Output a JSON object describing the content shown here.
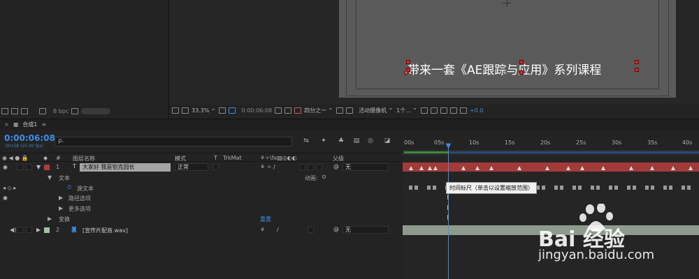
{
  "viewer": {
    "overlay_text": "带来一套《AE跟踪与应用》系列课程",
    "bpc": "8 bpc",
    "zoom": "33.3%",
    "timecode": "0:00:06:08",
    "resolution": "四分之一",
    "camera": "活动摄像机",
    "views": "1个...",
    "exposure": "+0.0"
  },
  "panel": {
    "tab_label": "合成1",
    "menu_icon": "hamburger-icon"
  },
  "timeline": {
    "timecode": "0:00:06:08",
    "timecode_sub": "00158 (25.00 fps)",
    "search_placeholder": "ρ.",
    "columns": {
      "hash": "#",
      "layer_name": "图层名称",
      "mode": "模式",
      "t": "T",
      "trkmat": "TrkMat",
      "parent": "父级"
    },
    "ruler_labels": [
      "00s",
      "05s",
      "10s",
      "15s",
      "20s",
      "25s",
      "30s",
      "35s",
      "40s"
    ],
    "layers": [
      {
        "index": "1",
        "type": "T",
        "name": "大家好 我是铂克园长",
        "mode": "正常",
        "parent": "无",
        "color": "#b33a3a"
      },
      {
        "index": "2",
        "type": "audio",
        "name": "[宣传片配音.wav]",
        "parent": "无",
        "color": "#9fc49f"
      }
    ],
    "text_group": "文本",
    "animate_label": "动画:",
    "source_text": "源文本",
    "path_options": "路径选项",
    "more_options": "更多选项",
    "transform": "变换",
    "reset": "重置",
    "tooltip": "时间标尺（单击以设置缩放范围）"
  },
  "watermark": {
    "brand": "Bai  经验",
    "url": "jingyan.baidu.com"
  },
  "colors": {
    "accent_blue": "#3d8ee8",
    "layer_red": "#a33a3a",
    "audio_bar": "#8e9a8e"
  }
}
